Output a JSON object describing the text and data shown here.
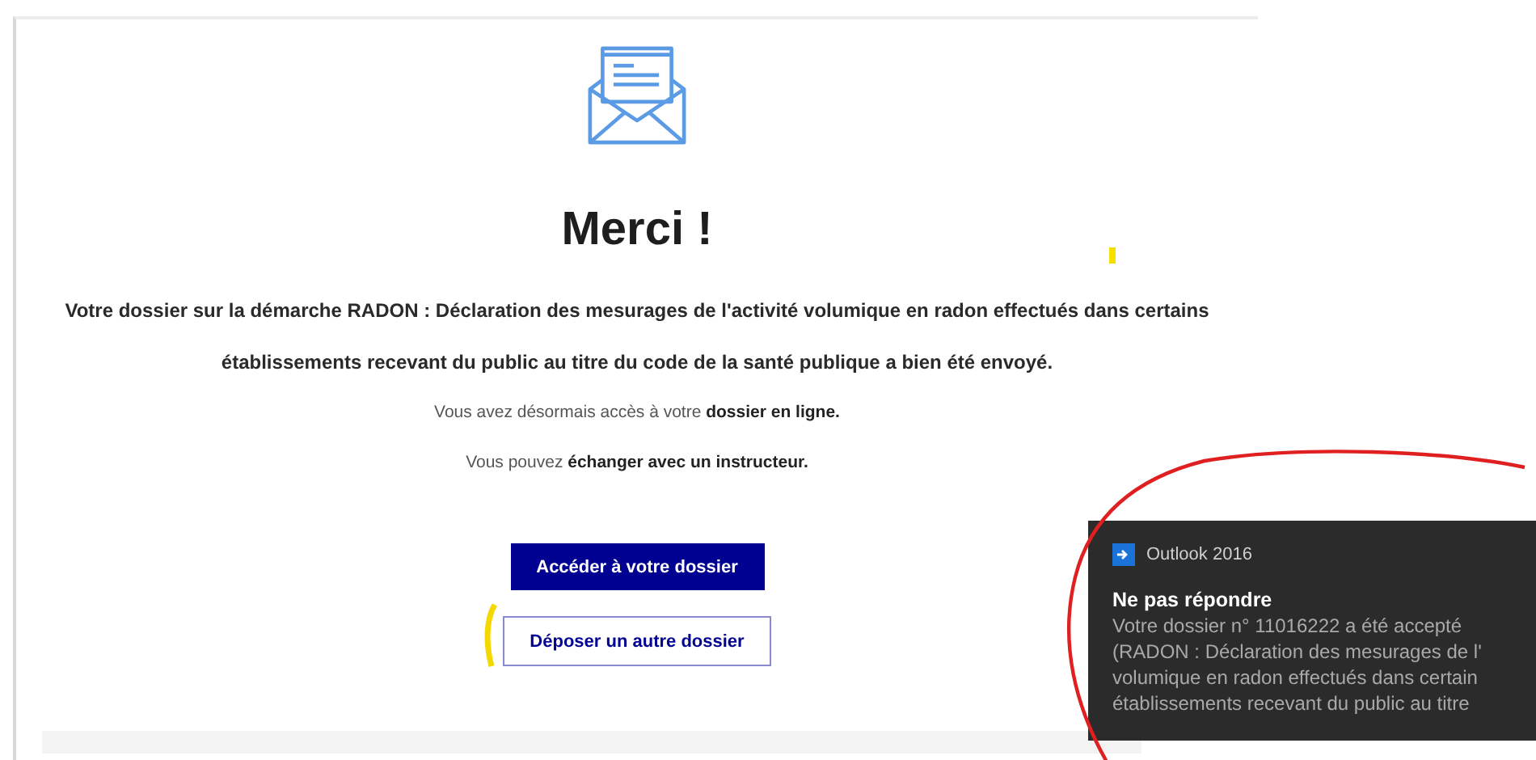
{
  "page": {
    "title": "Merci !",
    "message": "Votre dossier sur la démarche RADON : Déclaration des mesurages de l'activité volumique en radon effectués dans certains établissements recevant du public au titre du code de la santé publique a bien été envoyé.",
    "info_lines": [
      "Vous avez désormais accès à votre **dossier en ligne.**",
      "Vous pouvez **échanger avec un instructeur.**"
    ],
    "buttons": [
      {
        "label": "Accéder à votre dossier",
        "kind": "primary"
      },
      {
        "label": "Déposer un autre dossier",
        "kind": "secondary"
      }
    ]
  },
  "notification": {
    "app": "Outlook 2016",
    "sender": "Ne pas répondre",
    "body_lines": [
      "Votre dossier n° 11016222 a été accepté",
      "(RADON : Déclaration des mesurages de l'",
      "volumique en radon effectués dans certain",
      "établissements recevant du public au titre"
    ]
  }
}
